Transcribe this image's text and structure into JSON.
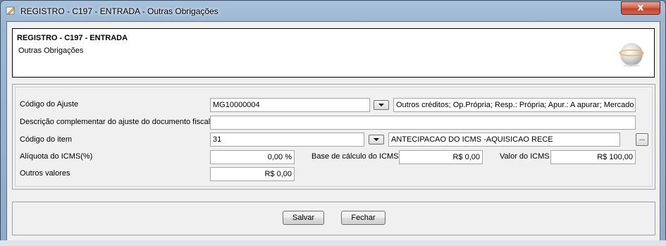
{
  "window": {
    "title": "REGISTRO - C197 - ENTRADA - Outras Obrigações",
    "close_label": "x"
  },
  "header": {
    "title": "REGISTRO - C197 - ENTRADA",
    "subtitle": "Outras Obrigações",
    "logo_icon": "globe-logo-icon"
  },
  "form": {
    "codigo_ajuste": {
      "label": "Código do Ajuste",
      "value": "MG10000004",
      "description": "Outros créditos; Op.Própria; Resp.: Própria; Apur.: A apurar; Mercado"
    },
    "descricao_complementar": {
      "label": "Descrição complementar do ajuste do documento fiscal",
      "value": ""
    },
    "codigo_item": {
      "label": "Código do item",
      "value": "31",
      "description": "ANTECIPACAO DO ICMS -AQUISICAO RECE",
      "lookup_label": "..."
    },
    "aliquota": {
      "label": "Alíquota do ICMS(%)",
      "value": "0,00 %"
    },
    "base_calculo": {
      "label": "Base de cálculo do ICMS",
      "value": "R$ 0,00"
    },
    "valor_icms": {
      "label": "Valor do ICMS",
      "value": "R$ 100,00"
    },
    "outros_valores": {
      "label": "Outros valores",
      "value": "R$ 0,00"
    }
  },
  "buttons": {
    "save_label": "Salvar",
    "close_label": "Fechar"
  }
}
